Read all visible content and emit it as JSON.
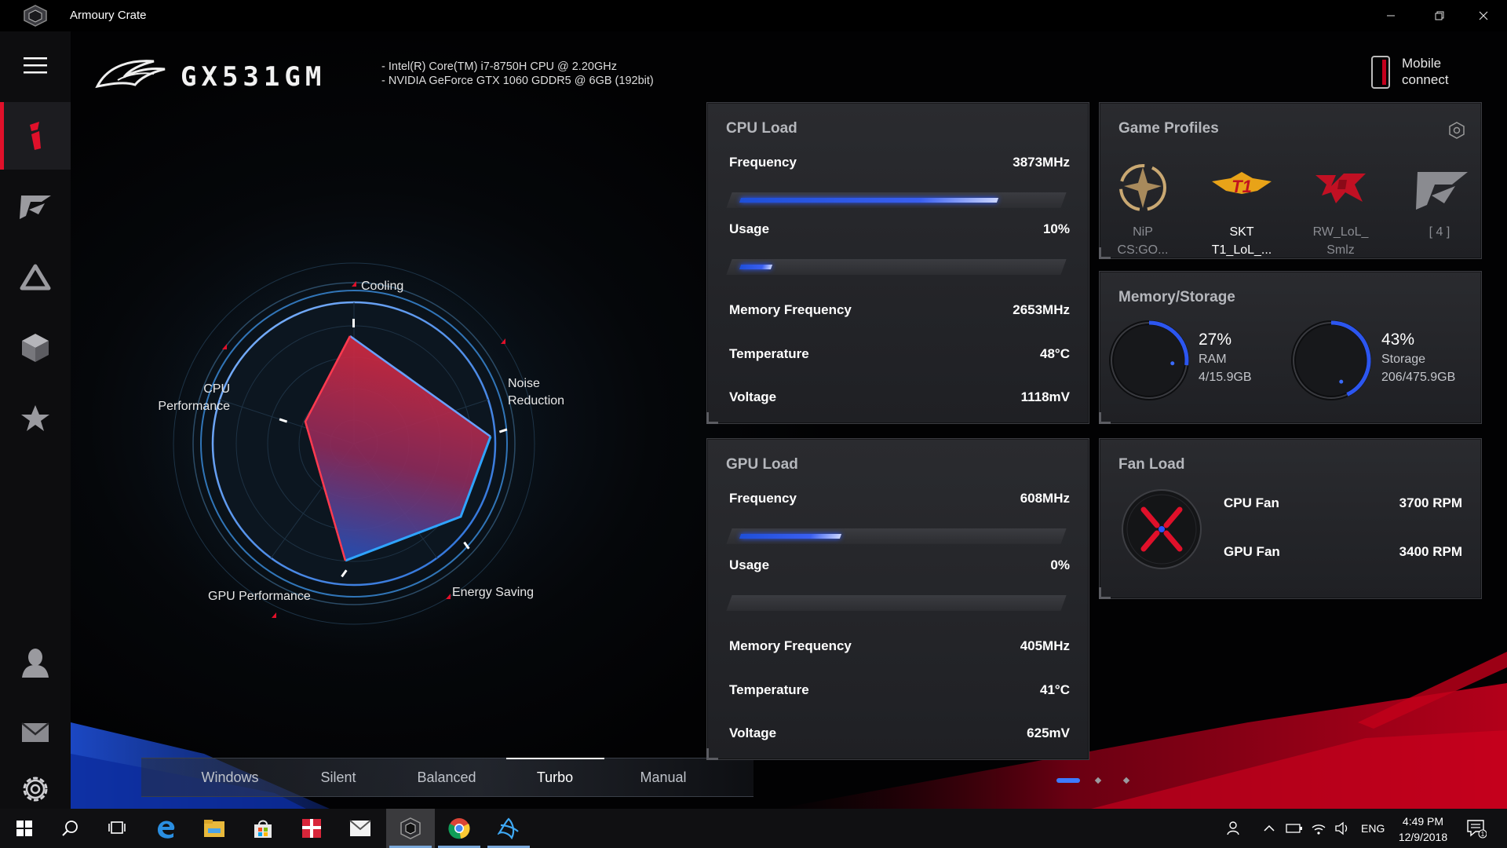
{
  "window": {
    "title": "Armoury Crate",
    "minimize_icon": "minimize-icon",
    "maximize_icon": "restore-icon",
    "close_icon": "close-icon"
  },
  "sidebar": {
    "items": [
      {
        "name": "menu",
        "icon": "hamburger-icon"
      },
      {
        "name": "home",
        "icon": "rog-eye-icon",
        "active": true
      },
      {
        "name": "game-library",
        "icon": "rog-slash-icon"
      },
      {
        "name": "aura",
        "icon": "triangle-icon"
      },
      {
        "name": "device",
        "icon": "cube-icon"
      },
      {
        "name": "featured",
        "icon": "star-icon"
      },
      {
        "name": "user-center",
        "icon": "user-icon"
      },
      {
        "name": "news",
        "icon": "mail-icon"
      },
      {
        "name": "settings",
        "icon": "gear-icon"
      }
    ]
  },
  "header": {
    "model": "GX531GM",
    "specs": [
      "-  Intel(R) Core(TM) i7-8750H CPU @ 2.20GHz",
      "-  NVIDIA GeForce GTX 1060 GDDR5 @ 6GB (192bit)"
    ],
    "mobile_connect_line1": "Mobile",
    "mobile_connect_line2": "connect"
  },
  "radar": {
    "labels": {
      "cooling": "Cooling",
      "cpu_line1": "CPU",
      "cpu_line2": "Performance",
      "noise_line1": "Noise",
      "noise_line2": "Reduction",
      "gpu": "GPU Performance",
      "energy": "Energy Saving"
    }
  },
  "modes": {
    "items": [
      "Windows",
      "Silent",
      "Balanced",
      "Turbo",
      "Manual"
    ],
    "selected": "Turbo"
  },
  "cpu_load": {
    "title": "CPU Load",
    "frequency_label": "Frequency",
    "frequency_value": "3873MHz",
    "frequency_fill": 0.82,
    "usage_label": "Usage",
    "usage_value": "10%",
    "usage_fill": 0.1,
    "mem_freq_label": "Memory Frequency",
    "mem_freq_value": "2653MHz",
    "temp_label": "Temperature",
    "temp_value": "48°C",
    "voltage_label": "Voltage",
    "voltage_value": "1118mV"
  },
  "gpu_load": {
    "title": "GPU Load",
    "frequency_label": "Frequency",
    "frequency_value": "608MHz",
    "frequency_fill": 0.32,
    "usage_label": "Usage",
    "usage_value": "0%",
    "usage_fill": 0.0,
    "mem_freq_label": "Memory Frequency",
    "mem_freq_value": "405MHz",
    "temp_label": "Temperature",
    "temp_value": "41°C",
    "voltage_label": "Voltage",
    "voltage_value": "625mV"
  },
  "game_profiles": {
    "title": "Game Profiles",
    "settings_icon": "hexagon-settings-icon",
    "profiles": [
      {
        "line1": "NiP",
        "line2": "CS:GO...",
        "icon": "nip-logo-icon"
      },
      {
        "line1": "SKT",
        "line2": "T1_LoL_...",
        "icon": "skt-t1-logo-icon"
      },
      {
        "line1": "RW_LoL_",
        "line2": "Smlz",
        "icon": "rw-logo-icon"
      },
      {
        "line1": "[ 4 ]",
        "line2": "",
        "icon": "rog-slash-icon"
      }
    ]
  },
  "memory_storage": {
    "title": "Memory/Storage",
    "ram": {
      "percent": "27%",
      "label": "RAM",
      "detail": "4/15.9GB",
      "fill": 0.27
    },
    "storage": {
      "percent": "43%",
      "label": "Storage",
      "detail": "206/475.9GB",
      "fill": 0.43
    }
  },
  "fan_load": {
    "title": "Fan Load",
    "cpu_fan_label": "CPU Fan",
    "cpu_fan_value": "3700 RPM",
    "gpu_fan_label": "GPU Fan",
    "gpu_fan_value": "3400 RPM"
  },
  "taskbar": {
    "apps": [
      "windows-start-icon",
      "search-icon",
      "task-view-icon",
      "edge-icon",
      "file-explorer-icon",
      "store-icon",
      "gift-icon",
      "mail-icon",
      "armoury-crate-icon",
      "chrome-icon",
      "battlenet-icon"
    ],
    "language": "ENG",
    "time": "4:49 PM",
    "date": "12/9/2018",
    "notification_count": "1"
  },
  "colors": {
    "accent_red": "#e0102a",
    "accent_blue": "#2a55ff",
    "panel_bg": "#25262a"
  }
}
